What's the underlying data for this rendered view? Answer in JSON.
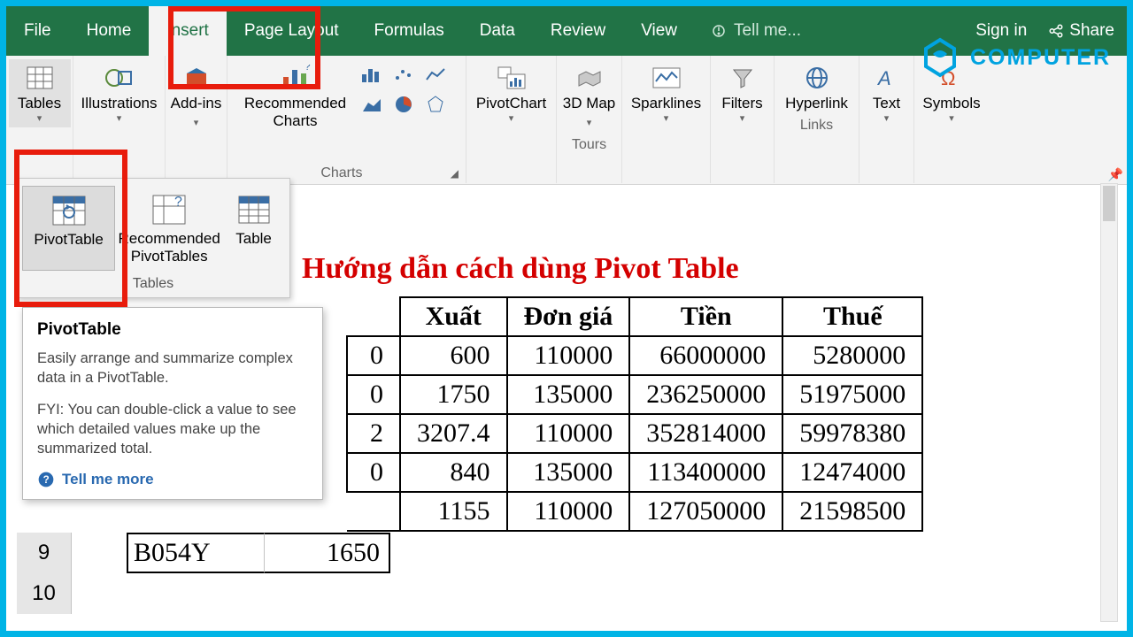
{
  "tabs": {
    "file": "File",
    "home": "Home",
    "insert": "Insert",
    "pagelayout": "Page Layout",
    "formulas": "Formulas",
    "data": "Data",
    "review": "Review",
    "view": "View",
    "tellme": "Tell me..."
  },
  "actions": {
    "signin": "Sign in",
    "share": "Share"
  },
  "ribbon": {
    "tables": "Tables",
    "illustrations": "Illustrations",
    "addins": "Add-ins",
    "recommended_charts": "Recommended Charts",
    "charts_group": "Charts",
    "pivotchart": "PivotChart",
    "map3d": "3D Map",
    "tours": "Tours",
    "sparklines": "Sparklines",
    "filters": "Filters",
    "hyperlink": "Hyperlink",
    "links": "Links",
    "text": "Text",
    "symbols": "Symbols"
  },
  "tables_dd": {
    "pivottable": "PivotTable",
    "recommended": "Recommended PivotTables",
    "table": "Table",
    "group": "Tables"
  },
  "tooltip": {
    "title": "PivotTable",
    "p1": "Easily arrange and summarize complex data in a PivotTable.",
    "p2": "FYI: You can double-click a value to see which detailed values make up the summarized total.",
    "more": "Tell me more"
  },
  "sheet": {
    "title": "Hướng dẫn cách dùng Pivot Table",
    "headers": [
      "Xuất",
      "Đơn giá",
      "Tiền",
      "Thuế"
    ],
    "rows": [
      {
        "hidden_a": "0",
        "xuat": "600",
        "dongia": "110000",
        "tien": "66000000",
        "thue": "5280000"
      },
      {
        "hidden_a": "0",
        "xuat": "1750",
        "dongia": "135000",
        "tien": "236250000",
        "thue": "51975000"
      },
      {
        "hidden_a": "2",
        "xuat": "3207.4",
        "dongia": "110000",
        "tien": "352814000",
        "thue": "59978380"
      },
      {
        "hidden_a": "0",
        "xuat": "840",
        "dongia": "135000",
        "tien": "113400000",
        "thue": "12474000"
      }
    ],
    "row9": {
      "num": "9",
      "code": "B054Y",
      "val": "1650",
      "xuat": "1155",
      "dongia": "110000",
      "tien": "127050000",
      "thue": "21598500"
    },
    "row10": "10"
  },
  "watermark": "COMPUTER"
}
